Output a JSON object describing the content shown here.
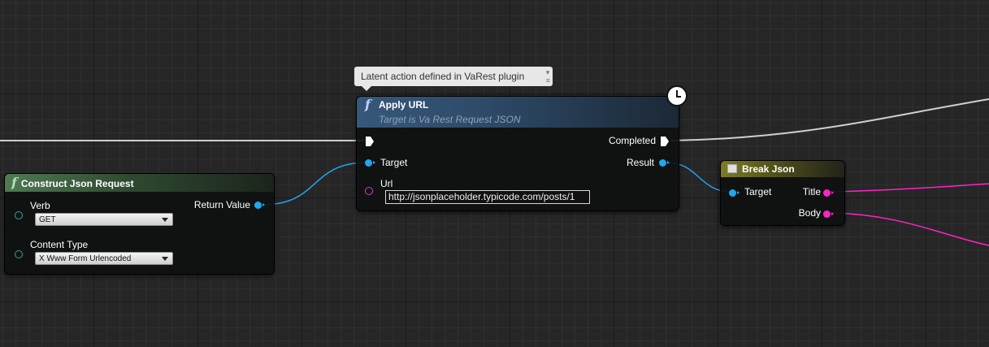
{
  "comment": {
    "text": "Latent action defined in VaRest plugin"
  },
  "construct_node": {
    "title": "Construct Json Request",
    "verb_label": "Verb",
    "verb_value": "GET",
    "content_type_label": "Content Type",
    "content_type_value": "X Www Form Urlencoded",
    "return_label": "Return Value"
  },
  "apply_node": {
    "title": "Apply URL",
    "subtitle": "Target is Va Rest Request JSON",
    "target_label": "Target",
    "url_label": "Url",
    "url_value": "http://jsonplaceholder.typicode.com/posts/1",
    "completed_label": "Completed",
    "result_label": "Result"
  },
  "break_node": {
    "title": "Break Json",
    "target_label": "Target",
    "title_pin_label": "Title",
    "body_pin_label": "Body"
  },
  "colors": {
    "object_pin": "#1fa7f0",
    "string_pin": "#ff22c8",
    "exec_wire": "#d8d8d8",
    "enum_pin": "#2aa6a0"
  }
}
